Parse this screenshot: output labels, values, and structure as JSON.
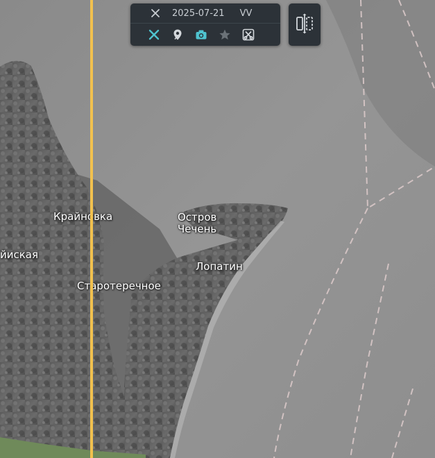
{
  "map": {
    "labels": [
      {
        "id": "krainovka",
        "text": "Крайновка"
      },
      {
        "id": "iyskaya",
        "text": "йиская"
      },
      {
        "id": "ostrov-chechen",
        "text": "Остров\nЧечень"
      },
      {
        "id": "lopatin",
        "text": "Лопатин"
      },
      {
        "id": "staroterechnoe",
        "text": "Старотеречное"
      }
    ]
  },
  "toolbar": {
    "date": "2025-07-21",
    "band": "VV",
    "icons": {
      "header_tool": "satellite-icon",
      "satellite": "satellite-icon",
      "location": "map-pin-icon",
      "camera": "camera-icon",
      "favorite": "star-icon",
      "crop": "scissors-crop-icon",
      "compare": "compare-split-icon"
    }
  },
  "colors": {
    "accent": "#4fc3cf",
    "divider": "#f2c14e",
    "panel": "#2c3238"
  }
}
